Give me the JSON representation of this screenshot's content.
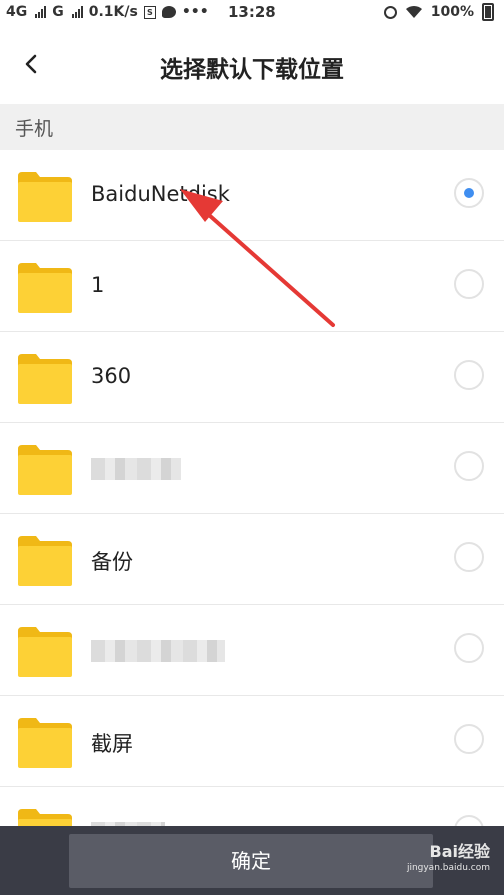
{
  "status_bar": {
    "network1": "4G",
    "network2": "G",
    "speed": "0.1K/s",
    "sim_box": "S",
    "dots": "•••",
    "time": "13:28",
    "battery": "100%"
  },
  "header": {
    "title": "选择默认下载位置"
  },
  "section": {
    "label": "手机"
  },
  "folders": [
    {
      "name": "BaiduNetdisk",
      "selected": true
    },
    {
      "name": "1",
      "selected": false
    },
    {
      "name": "360",
      "selected": false
    },
    {
      "name": "",
      "selected": false,
      "blurred": true
    },
    {
      "name": "备份",
      "selected": false
    },
    {
      "name": "",
      "selected": false,
      "blurred": true
    },
    {
      "name": "截屏",
      "selected": false
    },
    {
      "name": "",
      "selected": false,
      "blurred": true
    }
  ],
  "footer": {
    "confirm_label": "确定",
    "watermark": "Bai经验",
    "watermark_sub": "jingyan.baidu.com"
  },
  "colors": {
    "folder": "#FDD136",
    "folder_tab": "#F0B816",
    "radio_selected": "#3F8EF0",
    "bottom_bar": "#3A3C46",
    "annotation_arrow": "#E53935"
  }
}
